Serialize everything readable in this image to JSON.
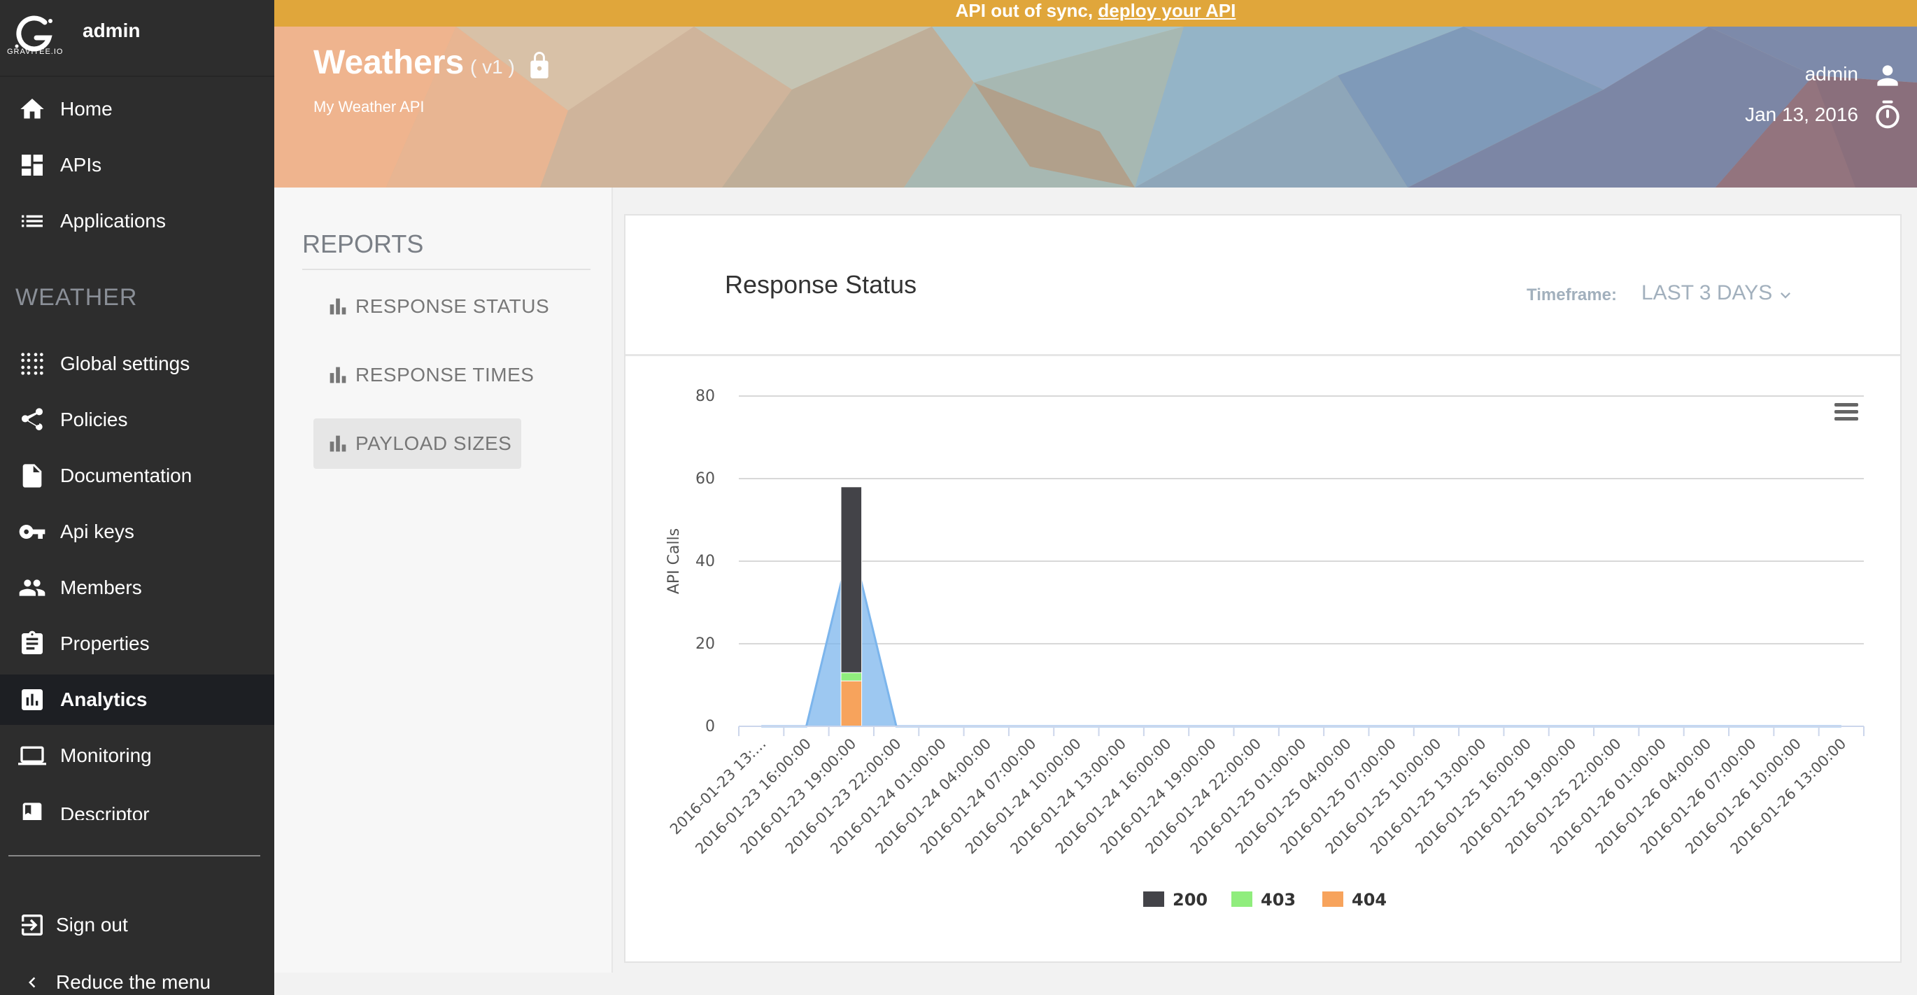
{
  "sidebar": {
    "logo_text": "GRAVITEE.IO",
    "user": "admin",
    "items": [
      {
        "label": "Home",
        "icon": "home-icon"
      },
      {
        "label": "APIs",
        "icon": "dashboard-icon"
      },
      {
        "label": "Applications",
        "icon": "list-icon"
      }
    ],
    "section_title": "WEATHER",
    "api_items": [
      {
        "label": "Global settings",
        "icon": "dots-grid-icon"
      },
      {
        "label": "Policies",
        "icon": "share-icon"
      },
      {
        "label": "Documentation",
        "icon": "document-icon"
      },
      {
        "label": "Api keys",
        "icon": "key-icon"
      },
      {
        "label": "Members",
        "icon": "people-icon"
      },
      {
        "label": "Properties",
        "icon": "clipboard-icon"
      },
      {
        "label": "Analytics",
        "icon": "bar-chart-icon",
        "active": true
      },
      {
        "label": "Monitoring",
        "icon": "laptop-icon"
      },
      {
        "label": "Descriptor",
        "icon": "book-icon"
      }
    ],
    "sign_out": "Sign out",
    "reduce_menu": "Reduce the menu"
  },
  "banner": {
    "text": "API out of sync,",
    "link": "deploy your API",
    "color": "#e0a63b"
  },
  "header": {
    "title": "Weathers",
    "version": "( v1 )",
    "subtitle": "My Weather API",
    "user": "admin",
    "date": "Jan 13, 2016"
  },
  "reports": {
    "title": "REPORTS",
    "items": [
      {
        "label": "RESPONSE STATUS"
      },
      {
        "label": "RESPONSE TIMES"
      },
      {
        "label": "PAYLOAD SIZES",
        "active": true
      }
    ]
  },
  "card": {
    "title": "Response Status",
    "timeframe_label": "Timeframe:",
    "timeframe_value": "LAST 3 DAYS"
  },
  "chart_data": {
    "type": "bar",
    "ylabel": "API Calls",
    "ylim": [
      0,
      80
    ],
    "yticks": [
      0,
      20,
      40,
      60,
      80
    ],
    "grid": true,
    "legend_position": "bottom",
    "categories": [
      "2016-01-23 13:…",
      "2016-01-23 16:00:00",
      "2016-01-23 19:00:00",
      "2016-01-23 22:00:00",
      "2016-01-24 01:00:00",
      "2016-01-24 04:00:00",
      "2016-01-24 07:00:00",
      "2016-01-24 10:00:00",
      "2016-01-24 13:00:00",
      "2016-01-24 16:00:00",
      "2016-01-24 19:00:00",
      "2016-01-24 22:00:00",
      "2016-01-25 01:00:00",
      "2016-01-25 04:00:00",
      "2016-01-25 07:00:00",
      "2016-01-25 10:00:00",
      "2016-01-25 13:00:00",
      "2016-01-25 16:00:00",
      "2016-01-25 19:00:00",
      "2016-01-25 22:00:00",
      "2016-01-26 01:00:00",
      "2016-01-26 04:00:00",
      "2016-01-26 07:00:00",
      "2016-01-26 10:00:00",
      "2016-01-26 13:00:00"
    ],
    "series": [
      {
        "name": "200",
        "color": "#434348",
        "values": [
          0,
          0,
          45,
          0,
          0,
          0,
          0,
          0,
          0,
          0,
          0,
          0,
          0,
          0,
          0,
          0,
          0,
          0,
          0,
          0,
          0,
          0,
          0,
          0,
          0
        ]
      },
      {
        "name": "403",
        "color": "#90ed7d",
        "values": [
          0,
          0,
          2,
          0,
          0,
          0,
          0,
          0,
          0,
          0,
          0,
          0,
          0,
          0,
          0,
          0,
          0,
          0,
          0,
          0,
          0,
          0,
          0,
          0,
          0
        ]
      },
      {
        "name": "404",
        "color": "#f7a35c",
        "values": [
          0,
          0,
          11,
          0,
          0,
          0,
          0,
          0,
          0,
          0,
          0,
          0,
          0,
          0,
          0,
          0,
          0,
          0,
          0,
          0,
          0,
          0,
          0,
          0,
          0
        ]
      }
    ],
    "area": {
      "color": "#7cb5ec",
      "values": [
        0,
        0,
        45,
        0,
        0,
        0,
        0,
        0,
        0,
        0,
        0,
        0,
        0,
        0,
        0,
        0,
        0,
        0,
        0,
        0,
        0,
        0,
        0,
        0,
        0
      ]
    }
  }
}
